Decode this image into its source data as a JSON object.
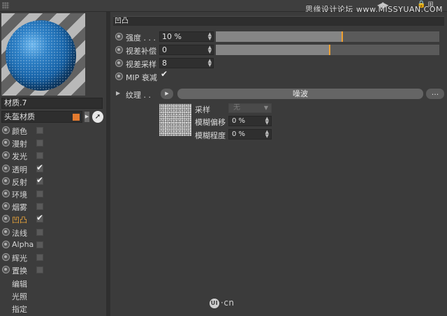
{
  "watermark": "思缘设计论坛 www.MISSYUAN.COM",
  "nav_arrows": "◀▶",
  "lock_icons": "🔒⊞",
  "material": {
    "name": "材质.7",
    "preset_name": "头盔材质",
    "preset_color": "#e37a2f"
  },
  "channels": [
    {
      "label": "颜色",
      "checked": false
    },
    {
      "label": "漫射",
      "checked": false
    },
    {
      "label": "发光",
      "checked": false
    },
    {
      "label": "透明",
      "checked": true
    },
    {
      "label": "反射",
      "checked": true
    },
    {
      "label": "环境",
      "checked": false
    },
    {
      "label": "烟雾",
      "checked": false
    },
    {
      "label": "凹凸",
      "checked": true,
      "active": true
    },
    {
      "label": "法线",
      "checked": false
    },
    {
      "label": "Alpha",
      "checked": false
    },
    {
      "label": "辉光",
      "checked": false
    },
    {
      "label": "置换",
      "checked": false
    }
  ],
  "plain_items": [
    "编辑",
    "光照",
    "指定"
  ],
  "bump": {
    "section_title": "凹凸",
    "strength": {
      "label": "强度 . . .",
      "value": "10 %",
      "slider": 0.565
    },
    "parallax_offset": {
      "label": "视差补偿",
      "value": "0",
      "slider": 0.51
    },
    "parallax_samples": {
      "label": "视差采样",
      "value": "8"
    },
    "mip": {
      "label": "MIP 衰减",
      "checked": true
    },
    "texture": {
      "label": "纹理 . .",
      "shader": "噪波",
      "more": "...",
      "sampling": {
        "label": "采样",
        "value": "无"
      },
      "blur_offset": {
        "label": "模糊偏移",
        "value": "0 %"
      },
      "blur_scale": {
        "label": "模糊程度",
        "value": "0 %"
      }
    }
  },
  "logo_text": "·cn",
  "logo_mark": "UI"
}
